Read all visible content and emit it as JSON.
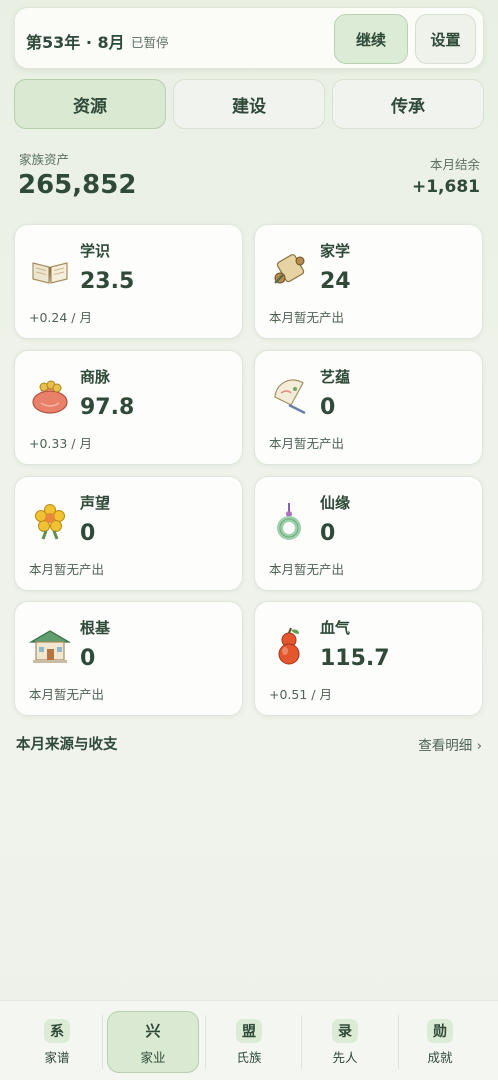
{
  "header": {
    "year_month": "第53年 · 8月",
    "status": "已暂停",
    "continue_label": "继续",
    "settings_label": "设置"
  },
  "tabs": [
    {
      "label": "资源",
      "active": true
    },
    {
      "label": "建设",
      "active": false
    },
    {
      "label": "传承",
      "active": false
    }
  ],
  "summary": {
    "asset_label": "家族资产",
    "asset_value": "265,852",
    "month_label": "本月结余",
    "month_value": "+1,681"
  },
  "resources": [
    {
      "name": "学识",
      "value": "23.5",
      "rate": "+0.24 / 月",
      "icon": "book-icon"
    },
    {
      "name": "家学",
      "value": "24",
      "rate": "本月暂无产出",
      "icon": "scroll-icon"
    },
    {
      "name": "商脉",
      "value": "97.8",
      "rate": "+0.33 / 月",
      "icon": "money-bag-icon"
    },
    {
      "name": "艺蕴",
      "value": "0",
      "rate": "本月暂无产出",
      "icon": "fan-icon"
    },
    {
      "name": "声望",
      "value": "0",
      "rate": "本月暂无产出",
      "icon": "medal-flower-icon"
    },
    {
      "name": "仙缘",
      "value": "0",
      "rate": "本月暂无产出",
      "icon": "jade-pendant-icon"
    },
    {
      "name": "根基",
      "value": "0",
      "rate": "本月暂无产出",
      "icon": "house-icon"
    },
    {
      "name": "血气",
      "value": "115.7",
      "rate": "+0.51 / 月",
      "icon": "gourd-icon"
    }
  ],
  "section": {
    "title": "本月来源与收支",
    "link": "查看明细 ›"
  },
  "nav": [
    {
      "glyph": "系",
      "label": "家谱",
      "active": false
    },
    {
      "glyph": "兴",
      "label": "家业",
      "active": true
    },
    {
      "glyph": "盟",
      "label": "氏族",
      "active": false
    },
    {
      "glyph": "录",
      "label": "先人",
      "active": false
    },
    {
      "glyph": "勋",
      "label": "成就",
      "active": false
    }
  ],
  "colors": {
    "accent": "#dae9d2",
    "text": "#2f4a39",
    "card_bg": "#fdfdfb"
  }
}
